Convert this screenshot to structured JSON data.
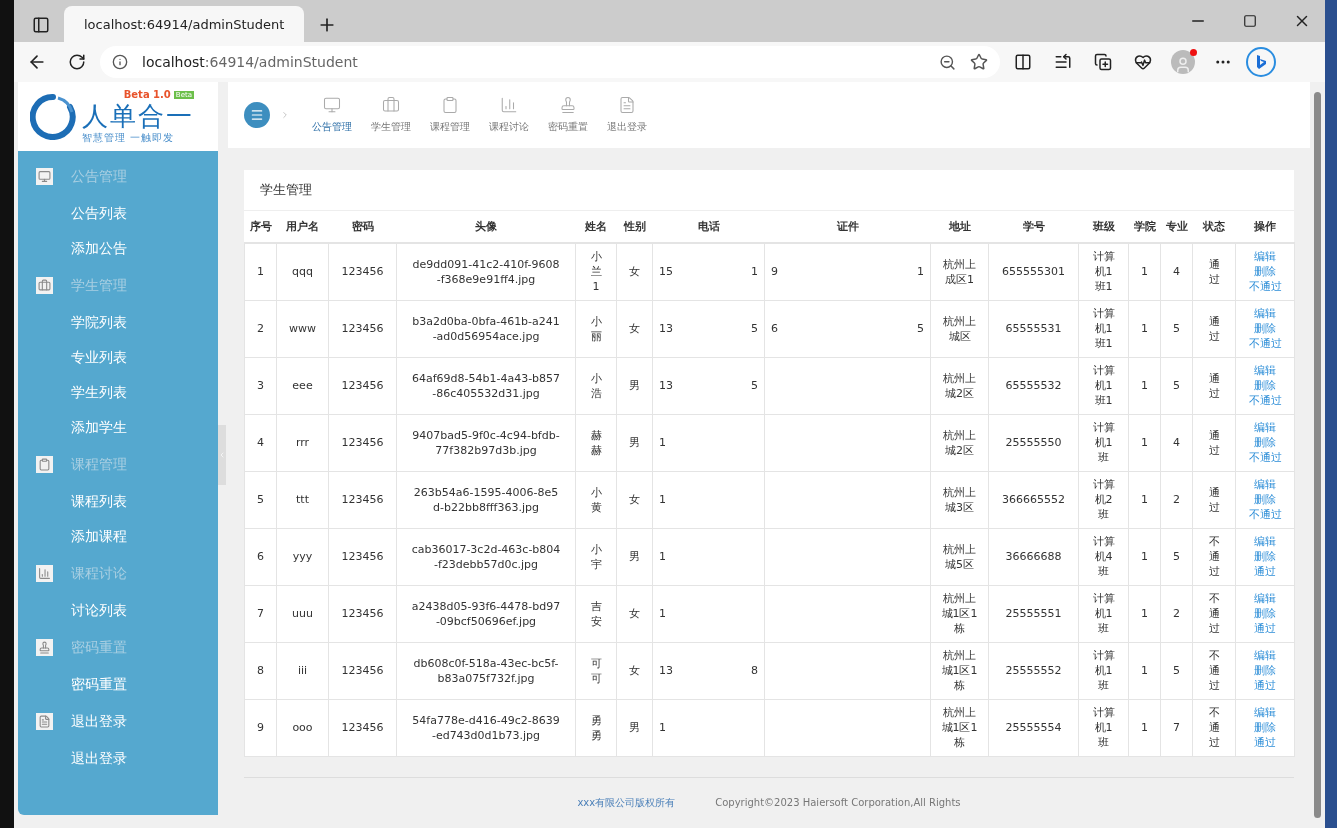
{
  "browser": {
    "tab_title": "localhost:64914/adminStudent",
    "url_host": "localhost",
    "url_path": ":64914/adminStudent"
  },
  "logo": {
    "title": "人单合一",
    "slogan": "智慧管理 一触即发",
    "version": "Beta 1.0",
    "badge": "Beta"
  },
  "sidebar": {
    "groups": [
      {
        "title": "公告管理",
        "muted": true,
        "items": [
          "公告列表",
          "添加公告"
        ]
      },
      {
        "title": "学生管理",
        "muted": true,
        "items": [
          "学院列表",
          "专业列表",
          "学生列表",
          "添加学生"
        ]
      },
      {
        "title": "课程管理",
        "muted": true,
        "items": [
          "课程列表",
          "添加课程"
        ]
      },
      {
        "title": "课程讨论",
        "muted": true,
        "items": [
          "讨论列表"
        ]
      },
      {
        "title": "密码重置",
        "muted": true,
        "items": [
          "密码重置"
        ]
      },
      {
        "title": "退出登录",
        "muted": false,
        "items": [
          "退出登录"
        ]
      }
    ]
  },
  "top_nav": [
    {
      "label": "公告管理",
      "selected": true
    },
    {
      "label": "学生管理",
      "selected": false
    },
    {
      "label": "课程管理",
      "selected": false
    },
    {
      "label": "课程讨论",
      "selected": false
    },
    {
      "label": "密码重置",
      "selected": false
    },
    {
      "label": "退出登录",
      "selected": false
    }
  ],
  "panel_title": "学生管理",
  "table": {
    "columns": [
      "序号",
      "用户名",
      "密码",
      "头像",
      "姓名",
      "性别",
      "电话",
      "证件",
      "地址",
      "学号",
      "班级",
      "学院",
      "专业",
      "状态",
      "操作"
    ],
    "rows": [
      {
        "no": "1",
        "username": "qqq",
        "password": "123456",
        "avatar": "de9dd091-41c2-410f-9608-f368e9e91ff4.jpg",
        "name": "小兰1",
        "gender": "女",
        "phone_start": "15",
        "phone_end": "1",
        "id_start": "9",
        "id_end": "1",
        "address": "杭州上成区1",
        "student_no": "655555301",
        "class": "计算机1班1",
        "college": "1",
        "major": "4",
        "status": "通过",
        "actions": [
          "编辑",
          "删除",
          "不通过"
        ]
      },
      {
        "no": "2",
        "username": "www",
        "password": "123456",
        "avatar": "b3a2d0ba-0bfa-461b-a241-ad0d56954ace.jpg",
        "name": "小丽",
        "gender": "女",
        "phone_start": "13",
        "phone_end": "5",
        "id_start": "6",
        "id_end": "5",
        "address": "杭州上城区",
        "student_no": "65555531",
        "class": "计算机1班1",
        "college": "1",
        "major": "5",
        "status": "通过",
        "actions": [
          "编辑",
          "删除",
          "不通过"
        ]
      },
      {
        "no": "3",
        "username": "eee",
        "password": "123456",
        "avatar": "64af69d8-54b1-4a43-b857-86c405532d31.jpg",
        "name": "小浩",
        "gender": "男",
        "phone_start": "13",
        "phone_end": "5",
        "address": "杭州上城2区",
        "student_no": "65555532",
        "class": "计算机1班1",
        "college": "1",
        "major": "5",
        "status": "通过",
        "actions": [
          "编辑",
          "删除",
          "不通过"
        ]
      },
      {
        "no": "4",
        "username": "rrr",
        "password": "123456",
        "avatar": "9407bad5-9f0c-4c94-bfdb-77f382b97d3b.jpg",
        "name": "赫赫",
        "gender": "男",
        "phone_start": "1",
        "address": "杭州上城2区",
        "student_no": "25555550",
        "class": "计算机1班",
        "college": "1",
        "major": "4",
        "status": "通过",
        "actions": [
          "编辑",
          "删除",
          "不通过"
        ]
      },
      {
        "no": "5",
        "username": "ttt",
        "password": "123456",
        "avatar": "263b54a6-1595-4006-8e5d-b22bb8fff363.jpg",
        "name": "小黄",
        "gender": "女",
        "phone_start": "1",
        "address": "杭州上城3区",
        "student_no": "366665552",
        "class": "计算机2班",
        "college": "1",
        "major": "2",
        "status": "通过",
        "actions": [
          "编辑",
          "删除",
          "不通过"
        ]
      },
      {
        "no": "6",
        "username": "yyy",
        "password": "123456",
        "avatar": "cab36017-3c2d-463c-b804-f23debb57d0c.jpg",
        "name": "小宇",
        "gender": "男",
        "phone_start": "1",
        "address": "杭州上城5区",
        "student_no": "36666688",
        "class": "计算机4班",
        "college": "1",
        "major": "5",
        "status": "不通过",
        "actions": [
          "编辑",
          "删除",
          "通过"
        ]
      },
      {
        "no": "7",
        "username": "uuu",
        "password": "123456",
        "avatar": "a2438d05-93f6-4478-bd97-09bcf50696ef.jpg",
        "name": "吉安",
        "gender": "女",
        "phone_start": "1",
        "address": "杭州上城1区1栋",
        "student_no": "25555551",
        "class": "计算机1班",
        "college": "1",
        "major": "2",
        "status": "不通过",
        "actions": [
          "编辑",
          "删除",
          "通过"
        ]
      },
      {
        "no": "8",
        "username": "iii",
        "password": "123456",
        "avatar": "db608c0f-518a-43ec-bc5f-b83a075f732f.jpg",
        "name": "可可",
        "gender": "女",
        "phone_start": "13",
        "phone_end": "8",
        "address": "杭州上城1区1栋",
        "student_no": "25555552",
        "class": "计算机1班",
        "college": "1",
        "major": "5",
        "status": "不通过",
        "actions": [
          "编辑",
          "删除",
          "通过"
        ]
      },
      {
        "no": "9",
        "username": "ooo",
        "password": "123456",
        "avatar": "54fa778e-d416-49c2-8639-ed743d0d1b73.jpg",
        "name": "勇勇",
        "gender": "男",
        "phone_start": "1",
        "address": "杭州上城1区1栋",
        "student_no": "25555554",
        "class": "计算机1班",
        "college": "1",
        "major": "7",
        "status": "不通过",
        "actions": [
          "编辑",
          "删除",
          "通过"
        ]
      }
    ]
  },
  "footer": {
    "company": "xxx有限公司版权所有",
    "copyright": "Copyright©2023 Haiersoft Corporation,All Rights"
  }
}
